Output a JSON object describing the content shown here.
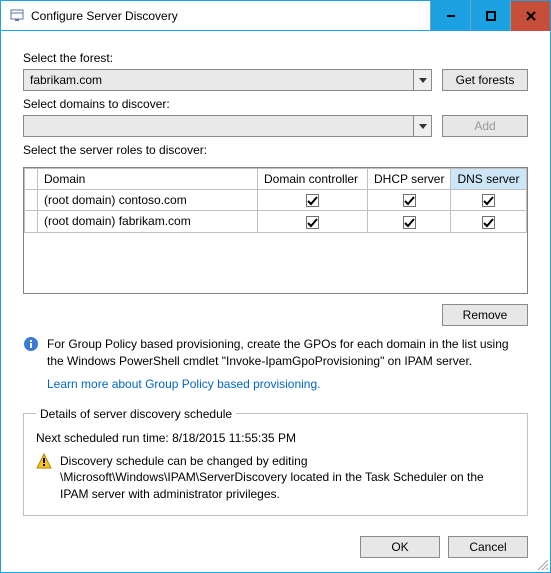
{
  "window": {
    "title": "Configure Server Discovery"
  },
  "forest": {
    "label": "Select the forest:",
    "value": "fabrikam.com",
    "get_button": "Get forests"
  },
  "domains": {
    "label": "Select domains to discover:",
    "value": "",
    "add_button": "Add"
  },
  "roles": {
    "label": "Select the server roles to discover:",
    "columns": [
      "Domain",
      "Domain controller",
      "DHCP server",
      "DNS server"
    ],
    "rows": [
      {
        "domain": "(root domain) contoso.com",
        "dc": true,
        "dhcp": true,
        "dns": true
      },
      {
        "domain": "(root domain) fabrikam.com",
        "dc": true,
        "dhcp": true,
        "dns": true
      }
    ],
    "remove_button": "Remove"
  },
  "info": {
    "text": "For Group Policy based provisioning, create the GPOs for each domain in the list using the Windows PowerShell cmdlet \"Invoke-IpamGpoProvisioning\" on IPAM server.",
    "link": "Learn more about Group Policy based provisioning."
  },
  "schedule": {
    "legend": "Details of server discovery schedule",
    "next_run": "Next scheduled run time: 8/18/2015 11:55:35 PM",
    "warn": "Discovery schedule can be changed by editing \\Microsoft\\Windows\\IPAM\\ServerDiscovery located in the Task Scheduler on the IPAM server with administrator privileges."
  },
  "footer": {
    "ok": "OK",
    "cancel": "Cancel"
  }
}
